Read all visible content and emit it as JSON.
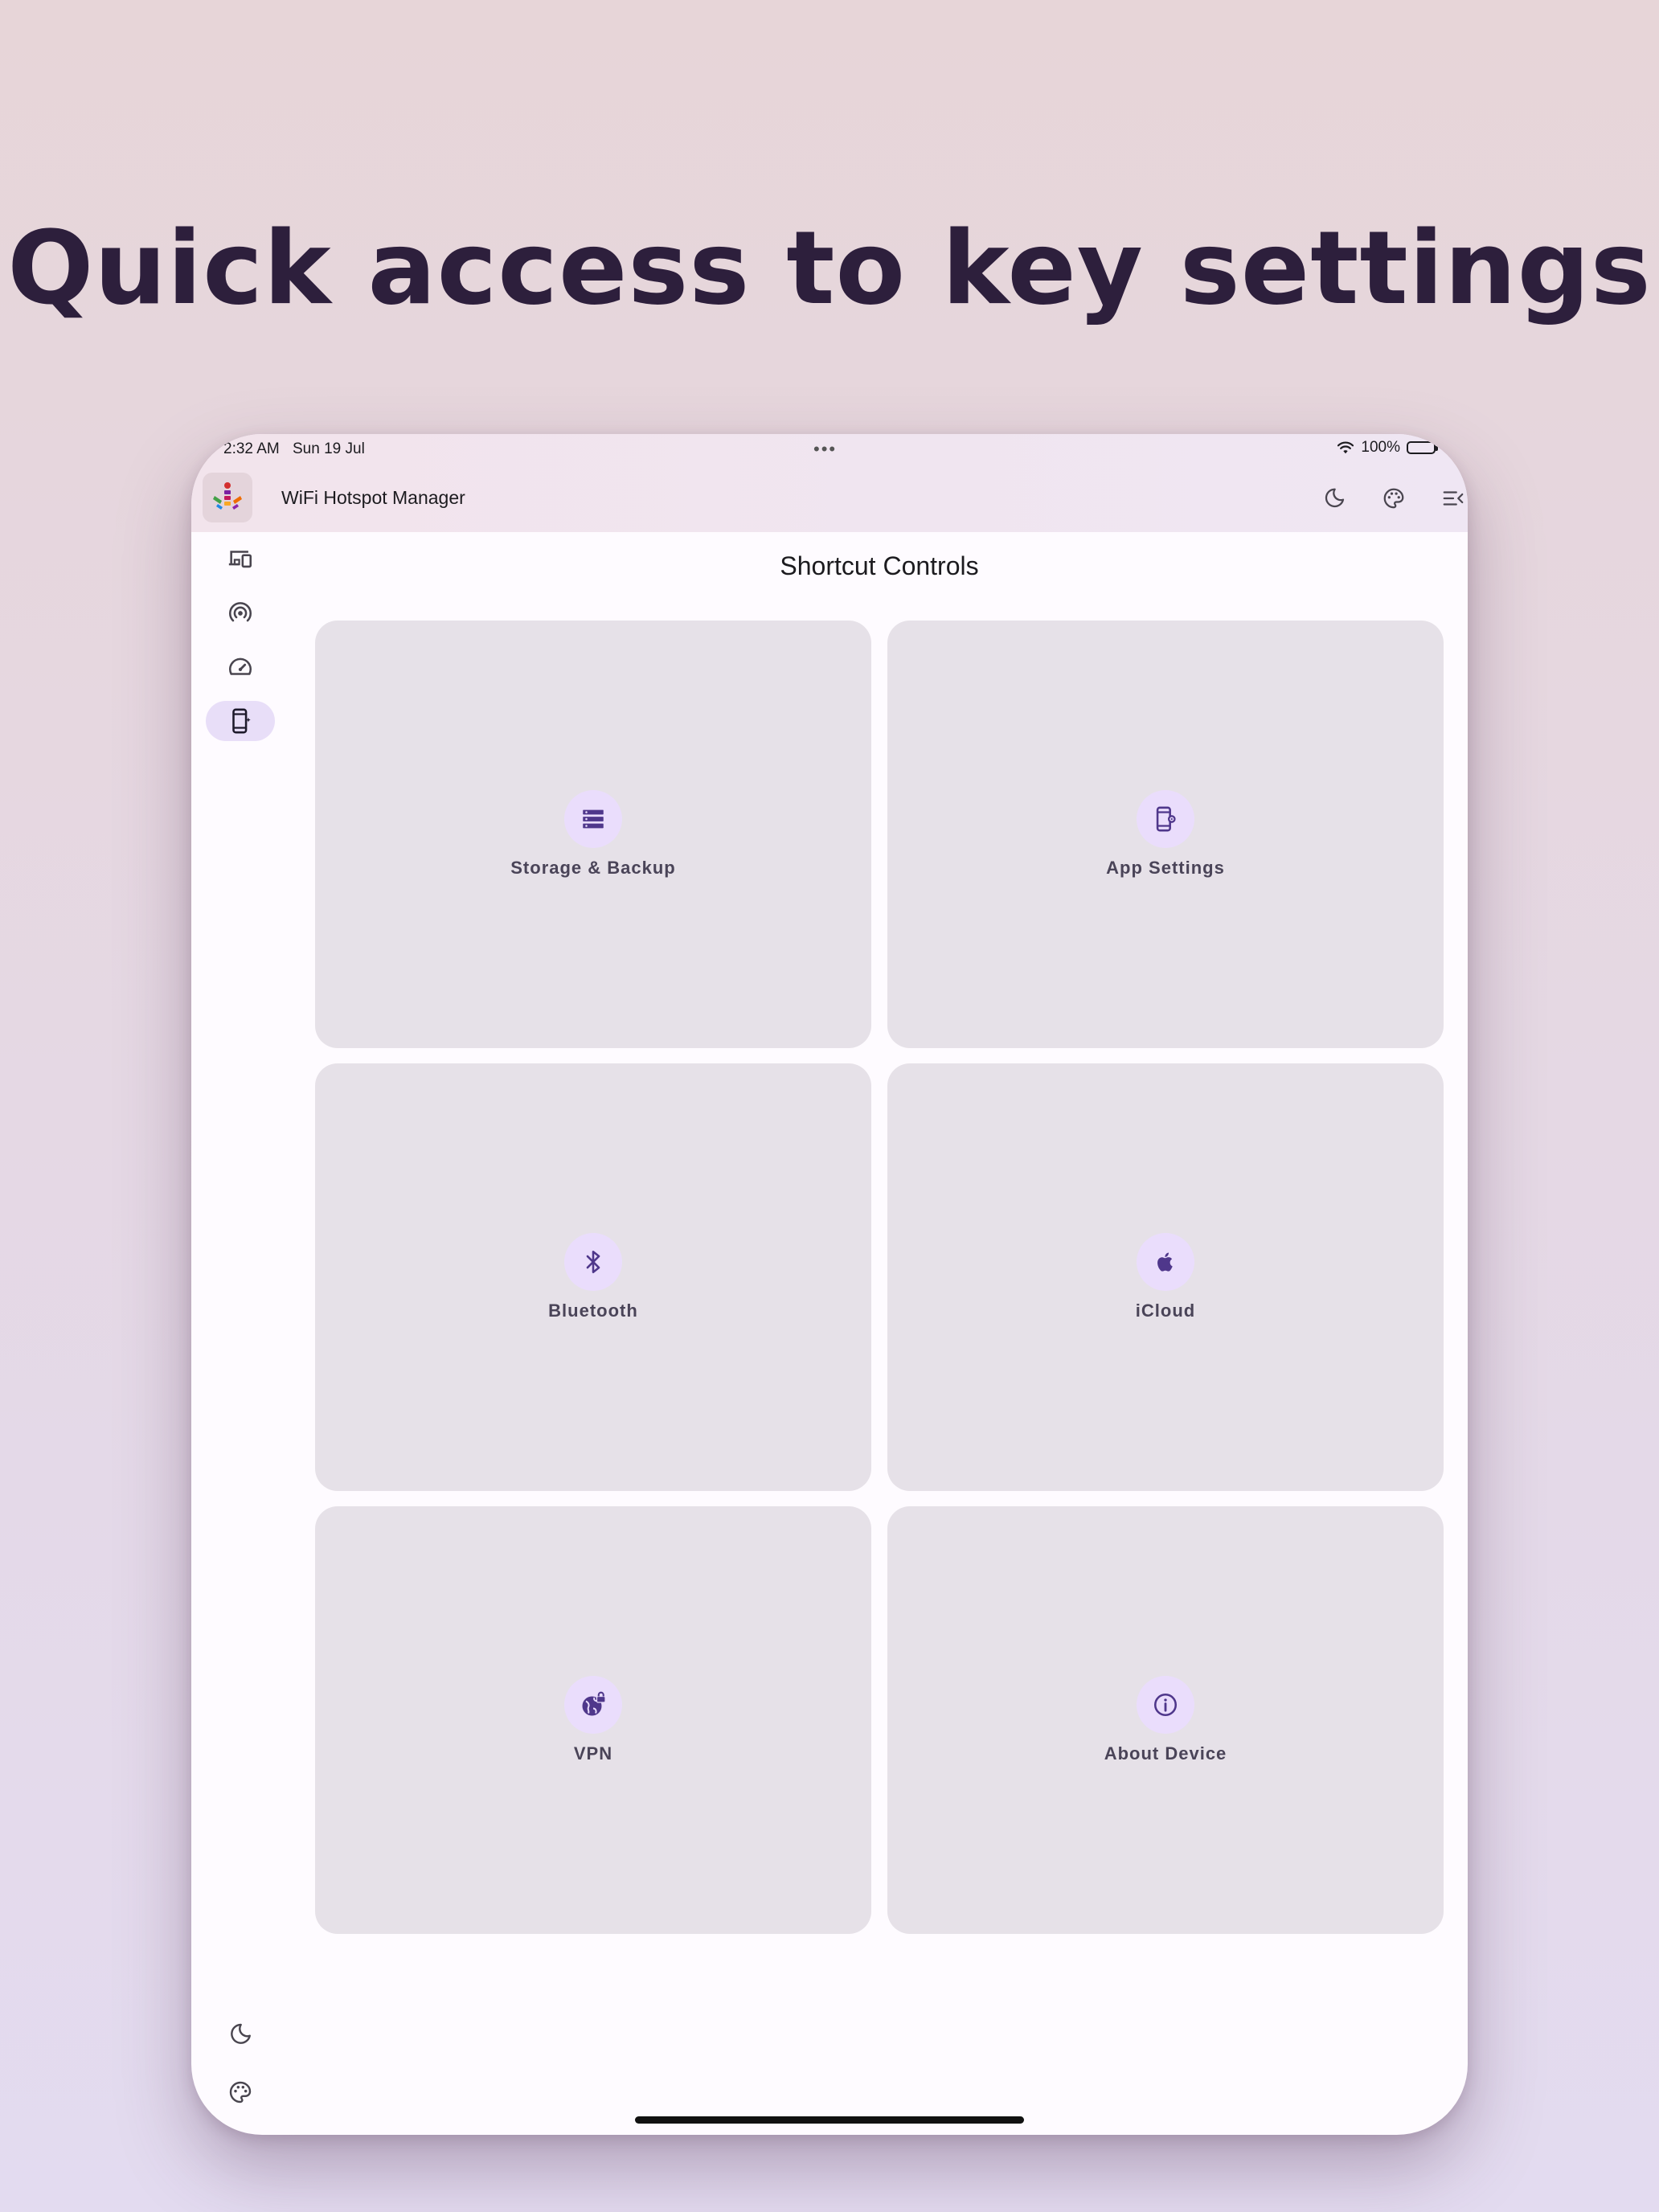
{
  "headline": "Quick access to key settings",
  "status_bar": {
    "time": "2:32 AM",
    "date": "Sun 19 Jul",
    "battery": "100%"
  },
  "app_bar": {
    "title": "WiFi Hotspot Manager",
    "actions": [
      "dark-mode-icon",
      "palette-icon",
      "menu-collapse-icon"
    ]
  },
  "nav_rail": {
    "items": [
      {
        "icon": "devices-icon",
        "active": false
      },
      {
        "icon": "hotspot-icon",
        "active": false
      },
      {
        "icon": "speedometer-icon",
        "active": false
      },
      {
        "icon": "phone-settings-icon",
        "active": true
      }
    ],
    "bottom_items": [
      "dark-mode-icon",
      "palette-icon"
    ]
  },
  "page": {
    "title": "Shortcut Controls"
  },
  "tiles": [
    {
      "label": "Storage & Backup",
      "icon": "storage-icon"
    },
    {
      "label": "App Settings",
      "icon": "app-settings-icon"
    },
    {
      "label": "Bluetooth",
      "icon": "bluetooth-icon"
    },
    {
      "label": "iCloud",
      "icon": "apple-icon"
    },
    {
      "label": "VPN",
      "icon": "vpn-globe-lock-icon"
    },
    {
      "label": "About Device",
      "icon": "info-icon"
    }
  ],
  "colors": {
    "tile_bg": "#e6e1e8",
    "icon_circle": "#eaddfc",
    "rail_active": "#e8def8",
    "headline": "#2d1f3c"
  }
}
